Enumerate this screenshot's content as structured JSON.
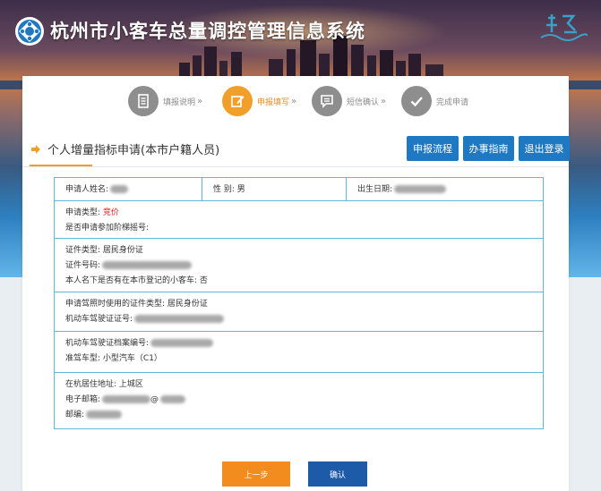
{
  "header": {
    "system_title": "杭州市小客车总量调控管理信息系统"
  },
  "steps": [
    {
      "label": "填报说明",
      "icon": "document-icon",
      "active": false
    },
    {
      "label": "申报填写",
      "icon": "edit-icon",
      "active": true
    },
    {
      "label": "短信确认",
      "icon": "message-icon",
      "active": false
    },
    {
      "label": "完成申请",
      "icon": "check-icon",
      "active": false
    }
  ],
  "section": {
    "title": "个人增量指标申请(本市户籍人员)",
    "buttons": {
      "process": "申报流程",
      "guide": "办事指南",
      "logout": "退出登录"
    }
  },
  "form": {
    "applicant_name_label": "申请人姓名:",
    "gender_label": "性 别:",
    "gender_value": "男",
    "birth_date_label": "出生日期:",
    "apply_type_label": "申请类型:",
    "apply_type_value": "竞价",
    "ladder_label": "是否申请参加阶梯摇号:",
    "id_type_label": "证件类型:",
    "id_type_value": "居民身份证",
    "id_number_label": "证件号码:",
    "has_car_label": "本人名下是否有在本市登记的小客车:",
    "has_car_value": "否",
    "license_id_type_label": "申请驾照时使用的证件类型:",
    "license_id_type_value": "居民身份证",
    "license_number_label": "机动车驾驶证证号:",
    "archive_number_label": "机动车驾驶证档案编号:",
    "vehicle_type_label": "准驾车型:",
    "vehicle_type_value": "小型汽车（C1）",
    "address_label": "在杭居住地址:",
    "address_value": "上城区",
    "email_label": "电子邮箱:",
    "email_visible_part": "@",
    "postcode_label": "邮编:"
  },
  "actions": {
    "prev": "上一步",
    "confirm": "确认"
  },
  "colors": {
    "primary_blue": "#1e78c2",
    "accent_orange": "#f0a02a",
    "table_border": "#5fb9d4",
    "warning_red": "#e02020"
  }
}
